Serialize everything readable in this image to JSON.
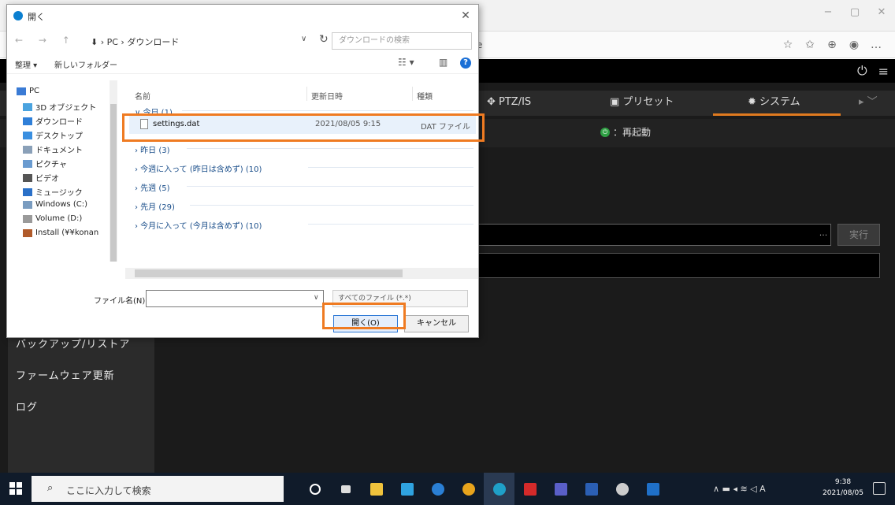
{
  "browser": {
    "address_fragment": "e",
    "window_controls": [
      "−",
      "▢",
      "✕"
    ],
    "toolbar_icons": [
      "☆",
      "✩",
      "⊕",
      "◉",
      "…"
    ]
  },
  "app": {
    "header_icons": [
      "⏻",
      "≡"
    ],
    "tabs": [
      {
        "label": "✥ PTZ/IS"
      },
      {
        "label": "▣ プリセット"
      },
      {
        "label": "✹ システム"
      }
    ],
    "tab_more": "▸  ﹀",
    "restart_icon": "⏻",
    "restart_label": "：再起動",
    "file_browse_label": "...",
    "execute_label": "実行",
    "menu": [
      "バックアップ/リストア",
      "ファームウェア更新",
      "ログ"
    ]
  },
  "dialog": {
    "title": "開く",
    "close": "✕",
    "nav_arrows": "← → ↑",
    "path": "⬇ › PC › ダウンロード",
    "path_dropdown": "∨",
    "refresh": "↻",
    "search_placeholder": "ダウンロードの検索",
    "toolbar": {
      "organize": "整理 ▾",
      "new_folder": "新しいフォルダー",
      "view": "☷ ▾",
      "pane": "▥",
      "help": "?"
    },
    "nav_tree": [
      {
        "label": "PC",
        "color": "#3a7bd5"
      },
      {
        "label": "3D オブジェクト",
        "color": "#4aa3df"
      },
      {
        "label": "ダウンロード",
        "color": "#2f7fd8"
      },
      {
        "label": "デスクトップ",
        "color": "#3a8fe0"
      },
      {
        "label": "ドキュメント",
        "color": "#8aa0b8"
      },
      {
        "label": "ピクチャ",
        "color": "#6a9bd0"
      },
      {
        "label": "ビデオ",
        "color": "#555555"
      },
      {
        "label": "ミュージック",
        "color": "#2a70c8"
      },
      {
        "label": "Windows (C:)",
        "color": "#7a9cc0"
      },
      {
        "label": "Volume (D:)",
        "color": "#9a9a9a"
      },
      {
        "label": "Install (¥¥konan",
        "color": "#b05a2a"
      }
    ],
    "columns": {
      "name": "名前",
      "date": "更新日時",
      "type": "種類"
    },
    "groups": {
      "today": "∨ 今日 (1)",
      "yesterday": "› 昨日 (3)",
      "this_week": "› 今週に入って (昨日は含めず) (10)",
      "last_week": "› 先週 (5)",
      "last_month": "› 先月 (29)",
      "this_month": "› 今月に入って (今月は含めず) (10)"
    },
    "file": {
      "name": "settings.dat",
      "date": "2021/08/05 9:15",
      "type": "DAT ファイル"
    },
    "filename_label": "ファイル名(N):",
    "filename_value": "",
    "filename_dropdown": "∨",
    "filter": "すべてのファイル (*.*)",
    "open_button": "開く(O)",
    "cancel_button": "キャンセル"
  },
  "taskbar": {
    "search_placeholder": "ここに入力して検索",
    "apps": [
      {
        "name": "cortana",
        "color": "#ffffff"
      },
      {
        "name": "task-view",
        "color": "#dddddd"
      },
      {
        "name": "explorer",
        "color": "#f0c33c"
      },
      {
        "name": "people",
        "color": "#2fa3e0"
      },
      {
        "name": "internet-explorer",
        "color": "#2a7fd4"
      },
      {
        "name": "chrome",
        "color": "#e8a41c"
      },
      {
        "name": "edge",
        "color": "#1fa0c8"
      },
      {
        "name": "acrobat",
        "color": "#d42a2a"
      },
      {
        "name": "teams",
        "color": "#5a5fc8"
      },
      {
        "name": "word",
        "color": "#2b5fb4"
      },
      {
        "name": "settings",
        "color": "#cccccc"
      },
      {
        "name": "outlook",
        "color": "#1f70c8"
      }
    ],
    "tray_icons": "∧ ▬ ◂ ≋ ◁ A",
    "time": "9:38",
    "date": "2021/08/05"
  },
  "colors": {
    "highlight": "#ef7b22",
    "tab_active": "#e07a1f",
    "app_bg": "#1b1b1b"
  }
}
